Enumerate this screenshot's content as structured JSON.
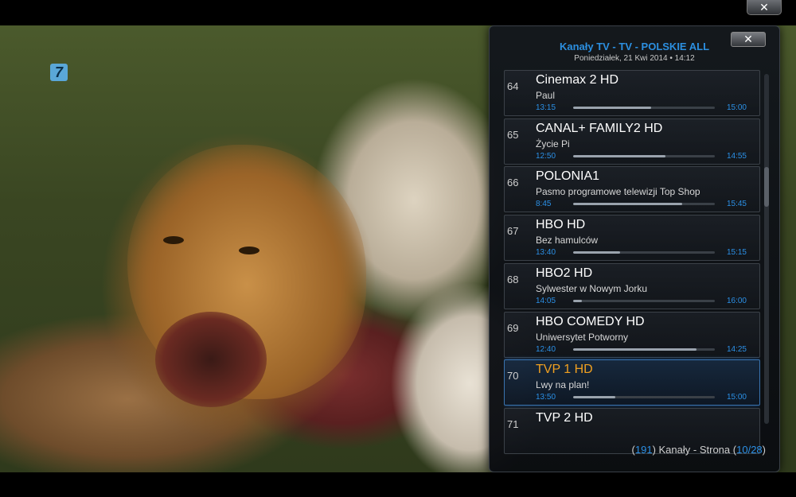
{
  "window": {
    "close_label": "✕"
  },
  "video": {
    "channel_logo_text": "7"
  },
  "panel": {
    "close_label": "✕",
    "title": "Kanały TV - TV - POLSKIE ALL",
    "date": "Poniedziałek, 21 Kwi 2014 • 14:12"
  },
  "channels": [
    {
      "number": "64",
      "name": "Cinemax 2 HD",
      "program": "Paul",
      "start": "13:15",
      "end": "15:00",
      "progress": 0.55,
      "selected": false
    },
    {
      "number": "65",
      "name": "CANAL+ FAMILY2 HD",
      "program": "Życie Pi",
      "start": "12:50",
      "end": "14:55",
      "progress": 0.65,
      "selected": false
    },
    {
      "number": "66",
      "name": "POLONIA1",
      "program": "Pasmo programowe telewizji Top Shop",
      "start": "8:45",
      "end": "15:45",
      "progress": 0.77,
      "selected": false
    },
    {
      "number": "67",
      "name": "HBO HD",
      "program": "Bez hamulców",
      "start": "13:40",
      "end": "15:15",
      "progress": 0.33,
      "selected": false
    },
    {
      "number": "68",
      "name": "HBO2 HD",
      "program": "Sylwester w Nowym Jorku",
      "start": "14:05",
      "end": "16:00",
      "progress": 0.06,
      "selected": false
    },
    {
      "number": "69",
      "name": "HBO COMEDY HD",
      "program": "Uniwersytet Potworny",
      "start": "12:40",
      "end": "14:25",
      "progress": 0.87,
      "selected": false
    },
    {
      "number": "70",
      "name": "TVP 1 HD",
      "program": "Lwy na plan!",
      "start": "13:50",
      "end": "15:00",
      "progress": 0.3,
      "selected": true
    },
    {
      "number": "71",
      "name": "TVP 2 HD",
      "program": "",
      "start": "",
      "end": "",
      "progress": 0.0,
      "selected": false
    }
  ],
  "scrollbar": {
    "position": 0.3
  },
  "footer": {
    "channel_count": "191",
    "channels_word": "Kanały",
    "page_word": "Strona",
    "page_current": "10",
    "page_total": "28"
  },
  "colors": {
    "accent_blue": "#2b90e6",
    "selected_orange": "#f0a020"
  }
}
